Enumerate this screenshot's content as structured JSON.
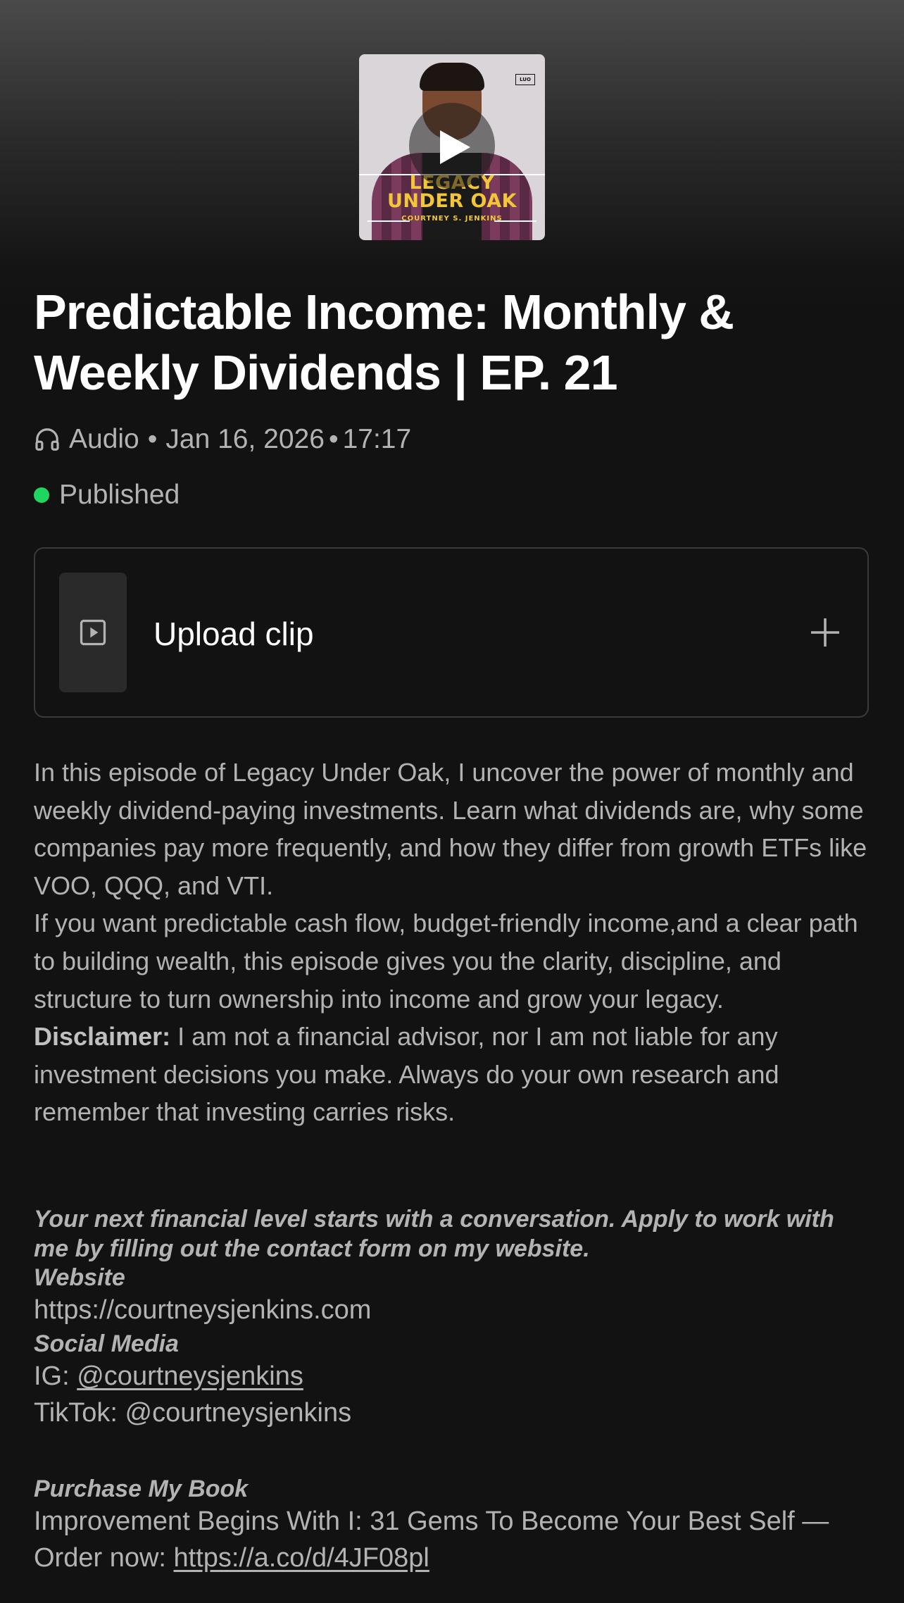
{
  "cover": {
    "title_line1": "LEGACY",
    "title_line2": "UNDER OAK",
    "author": "COURTNEY S. JENKINS",
    "logo": "LUO"
  },
  "episode": {
    "title": "Predictable Income: Monthly & Weekly Dividends | EP. 21",
    "type": "Audio",
    "date": "Jan 16, 2026",
    "duration": "17:17",
    "status": "Published"
  },
  "upload": {
    "label": "Upload clip"
  },
  "description": {
    "p1": "In this episode of Legacy Under Oak, I uncover the power of monthly and weekly dividend-paying investments. Learn what dividends are, why some companies pay more frequently, and how they differ from growth ETFs like VOO, QQQ, and VTI.",
    "p2": "If you want predictable cash flow, budget-friendly income,and a clear path to building wealth, this episode gives you the clarity, discipline, and structure to turn ownership into income and grow your legacy.",
    "disclaimer_label": "Disclaimer:",
    "disclaimer_text": " I am not a financial advisor, nor I am not liable for any investment decisions you make. Always do your own research and remember that investing carries risks."
  },
  "cta": {
    "text": "Your next financial level starts with a conversation. Apply to work with me by filling out the contact form on my website."
  },
  "website": {
    "heading": "Website",
    "url": "https://courtneysjenkins.com"
  },
  "social": {
    "heading": "Social Media",
    "ig_label": "IG: ",
    "ig_handle": "@courtneysjenkins",
    "tiktok": "TikTok: @courtneysjenkins"
  },
  "book": {
    "heading": "Purchase My Book",
    "title": "Improvement Begins With I: 31 Gems To Become Your Best Self —",
    "order_label": "Order now: ",
    "order_link": "https://a.co/d/4JF08pl"
  },
  "colors": {
    "background": "#121212",
    "text_primary": "#ffffff",
    "text_secondary": "#b3b3b3",
    "status_green": "#1ed760",
    "cover_accent": "#f3c63a"
  }
}
